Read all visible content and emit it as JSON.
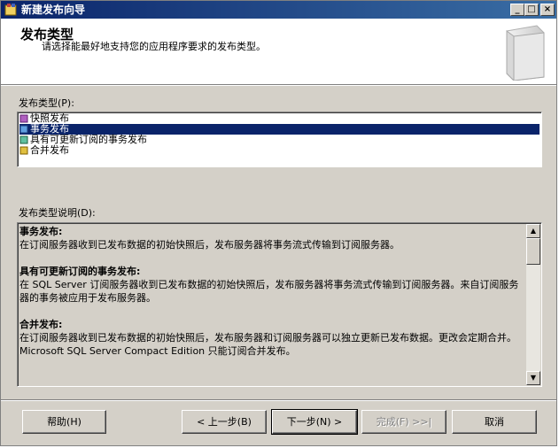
{
  "window": {
    "title": "新建发布向导",
    "controls": [
      "_",
      "□",
      "×"
    ]
  },
  "header": {
    "title": "发布类型",
    "subtitle": "请选择能最好地支持您的应用程序要求的发布类型。"
  },
  "publication_types": {
    "label": "发布类型(P):",
    "items": [
      {
        "label": "快照发布",
        "icon": "snapshot-publication-icon",
        "selected": false
      },
      {
        "label": "事务发布",
        "icon": "transactional-publication-icon",
        "selected": true
      },
      {
        "label": "具有可更新订阅的事务发布",
        "icon": "updatable-transactional-publication-icon",
        "selected": false
      },
      {
        "label": "合并发布",
        "icon": "merge-publication-icon",
        "selected": false
      }
    ]
  },
  "description": {
    "label": "发布类型说明(D):",
    "sections": [
      {
        "heading": "事务发布:",
        "text": "在订阅服务器收到已发布数据的初始快照后，发布服务器将事务流式传输到订阅服务器。"
      },
      {
        "heading": "具有可更新订阅的事务发布:",
        "text": "在 SQL Server 订阅服务器收到已发布数据的初始快照后，发布服务器将事务流式传输到订阅服务器。来自订阅服务器的事务被应用于发布服务器。"
      },
      {
        "heading": "合并发布:",
        "text": "在订阅服务器收到已发布数据的初始快照后，发布服务器和订阅服务器可以独立更新已发布数据。更改会定期合并。Microsoft SQL Server Compact Edition 只能订阅合并发布。"
      }
    ]
  },
  "buttons": {
    "help": "帮助(H)",
    "back": "< 上一步(B)",
    "next": "下一步(N) >",
    "finish": "完成(F) >>|",
    "cancel": "取消"
  }
}
